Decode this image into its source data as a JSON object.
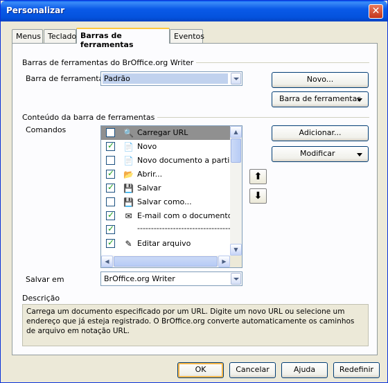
{
  "window": {
    "title": "Personalizar",
    "close_glyph": "✕"
  },
  "tabs": [
    {
      "label": "Menus"
    },
    {
      "label": "Teclado"
    },
    {
      "label": "Barras de ferramentas"
    },
    {
      "label": "Eventos"
    }
  ],
  "section1": {
    "title": "Barras de ferramentas do BrOffice.org Writer",
    "toolbar_label": "Barra de ferramentas",
    "toolbar_value": "Padrão",
    "new_button": "Novo...",
    "toolbar_menu_button": "Barra de ferramentas"
  },
  "section2": {
    "title": "Conteúdo da barra de ferramentas",
    "commands_label": "Comandos",
    "add_button": "Adicionar...",
    "modify_button": "Modificar",
    "items": [
      {
        "label": "Carregar URL",
        "checked": false,
        "icon": "load-url-icon",
        "glyph": "🔍"
      },
      {
        "label": "Novo",
        "checked": true,
        "icon": "new-document-icon",
        "glyph": "📄"
      },
      {
        "label": "Novo documento a partir de",
        "checked": false,
        "icon": "new-from-template-icon",
        "glyph": "📄"
      },
      {
        "label": "Abrir...",
        "checked": true,
        "icon": "open-folder-icon",
        "glyph": "📂"
      },
      {
        "label": "Salvar",
        "checked": true,
        "icon": "save-icon",
        "glyph": "💾"
      },
      {
        "label": "Salvar como...",
        "checked": false,
        "icon": "save-as-icon",
        "glyph": "💾"
      },
      {
        "label": "E-mail com o documento ane",
        "checked": true,
        "icon": "email-icon",
        "glyph": "✉"
      },
      {
        "label": "------------------------------------",
        "checked": true,
        "icon": "",
        "glyph": ""
      },
      {
        "label": "Editar arquivo",
        "checked": true,
        "icon": "edit-file-icon",
        "glyph": "✎"
      }
    ],
    "save_in_label": "Salvar em",
    "save_in_value": "BrOffice.org Writer"
  },
  "description": {
    "label": "Descrição",
    "text": "Carrega um documento especificado por um URL. Digite um novo URL ou selecione um endereço que já esteja registrado. O BrOffice.org converte automaticamente os caminhos de arquivo em notação URL."
  },
  "footer": {
    "ok": "OK",
    "cancel": "Cancelar",
    "help": "Ajuda",
    "reset": "Redefinir"
  },
  "colors": {
    "title_bar": "#0a5ae8",
    "selected_row": "#909090",
    "window_bg": "#ece9d8"
  }
}
